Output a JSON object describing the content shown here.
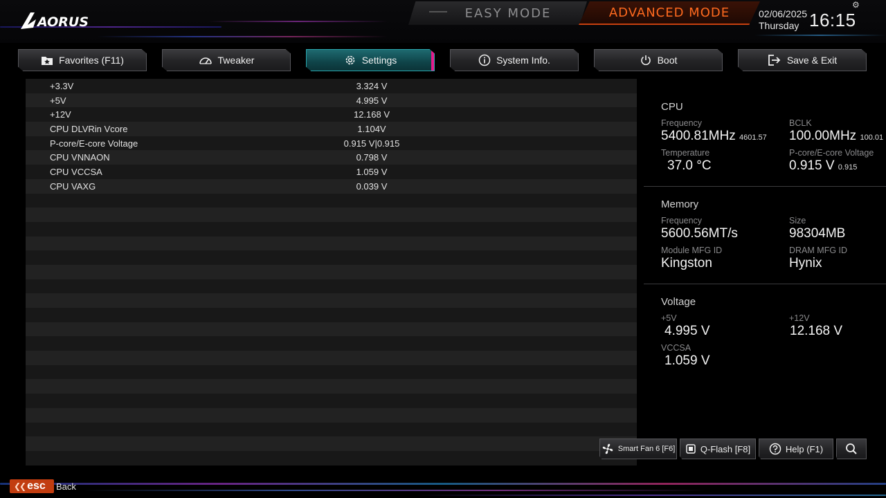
{
  "header": {
    "brand": "AORUS",
    "easy_mode": "EASY MODE",
    "advanced_mode": "ADVANCED MODE",
    "date": "02/06/2025",
    "weekday": "Thursday",
    "time": "16:15"
  },
  "tabs": [
    {
      "label": "Favorites (F11)",
      "icon": "star-folder-icon"
    },
    {
      "label": "Tweaker",
      "icon": "speedometer-icon"
    },
    {
      "label": "Settings",
      "icon": "gear-icon",
      "active": true
    },
    {
      "label": "System Info.",
      "icon": "info-icon"
    },
    {
      "label": "Boot",
      "icon": "power-icon"
    },
    {
      "label": "Save & Exit",
      "icon": "exit-icon"
    }
  ],
  "voltages": [
    {
      "label": "+3.3V",
      "value": "3.324 V"
    },
    {
      "label": "+5V",
      "value": "4.995 V"
    },
    {
      "label": "+12V",
      "value": "12.168 V"
    },
    {
      "label": "CPU DLVRin Vcore",
      "value": "1.104V"
    },
    {
      "label": "P-core/E-core Voltage",
      "value": "0.915 V|0.915"
    },
    {
      "label": "CPU VNNAON",
      "value": "0.798 V"
    },
    {
      "label": "CPU VCCSA",
      "value": "1.059 V"
    },
    {
      "label": "CPU VAXG",
      "value": "0.039 V"
    }
  ],
  "panel": {
    "cpu": {
      "title": "CPU",
      "frequency_label": "Frequency",
      "frequency": "5400.81MHz",
      "frequency_sub": "4601.57",
      "bclk_label": "BCLK",
      "bclk": "100.00MHz",
      "bclk_sub": "100.01",
      "temperature_label": "Temperature",
      "temperature": "37.0 °C",
      "pe_voltage_label": "P-core/E-core Voltage",
      "pe_voltage": "0.915 V",
      "pe_voltage_sub": "0.915"
    },
    "memory": {
      "title": "Memory",
      "frequency_label": "Frequency",
      "frequency": "5600.56MT/s",
      "size_label": "Size",
      "size": "98304MB",
      "module_mfg_label": "Module MFG ID",
      "module_mfg": "Kingston",
      "dram_mfg_label": "DRAM MFG ID",
      "dram_mfg": "Hynix"
    },
    "voltage": {
      "title": "Voltage",
      "v5_label": "+5V",
      "v5": "4.995 V",
      "v12_label": "+12V",
      "v12": "12.168 V",
      "vccsa_label": "VCCSA",
      "vccsa": "1.059 V"
    }
  },
  "bottom_buttons": [
    {
      "label": "Smart Fan 6 [F6]",
      "icon": "fan-icon"
    },
    {
      "label": "Q-Flash [F8]",
      "icon": "chip-icon"
    },
    {
      "label": "Help (F1)",
      "icon": "help-icon"
    },
    {
      "label": "",
      "icon": "search-icon"
    }
  ],
  "footer": {
    "esc_label": "esc",
    "back_label": "Back"
  },
  "colors": {
    "accent_orange": "#ff6a1f",
    "accent_teal": "#1e6a70",
    "accent_pink": "#e6198a"
  }
}
